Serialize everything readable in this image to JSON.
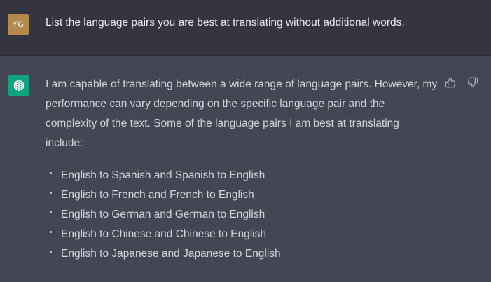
{
  "user_message": {
    "avatar_initials": "YG",
    "text": "List the language pairs you are best at translating without additional words."
  },
  "assistant_message": {
    "avatar_icon": "openai-logo-icon",
    "intro": "I am capable of translating between a wide range of language pairs. However, my performance can vary depending on the specific language pair and the complexity of the text. Some of the language pairs I am best at translating include:",
    "items": [
      "English to Spanish and Spanish to English",
      "English to French and French to English",
      "English to German and German to English",
      "English to Chinese and Chinese to English",
      "English to Japanese and Japanese to English"
    ],
    "feedback": {
      "thumbs_up_icon": "thumbs-up-icon",
      "thumbs_down_icon": "thumbs-down-icon"
    }
  },
  "colors": {
    "user_bg": "#343541",
    "assistant_bg": "#444654",
    "user_avatar": "#b48a4c",
    "bot_avatar": "#10a37f",
    "text": "#d1d5db"
  }
}
